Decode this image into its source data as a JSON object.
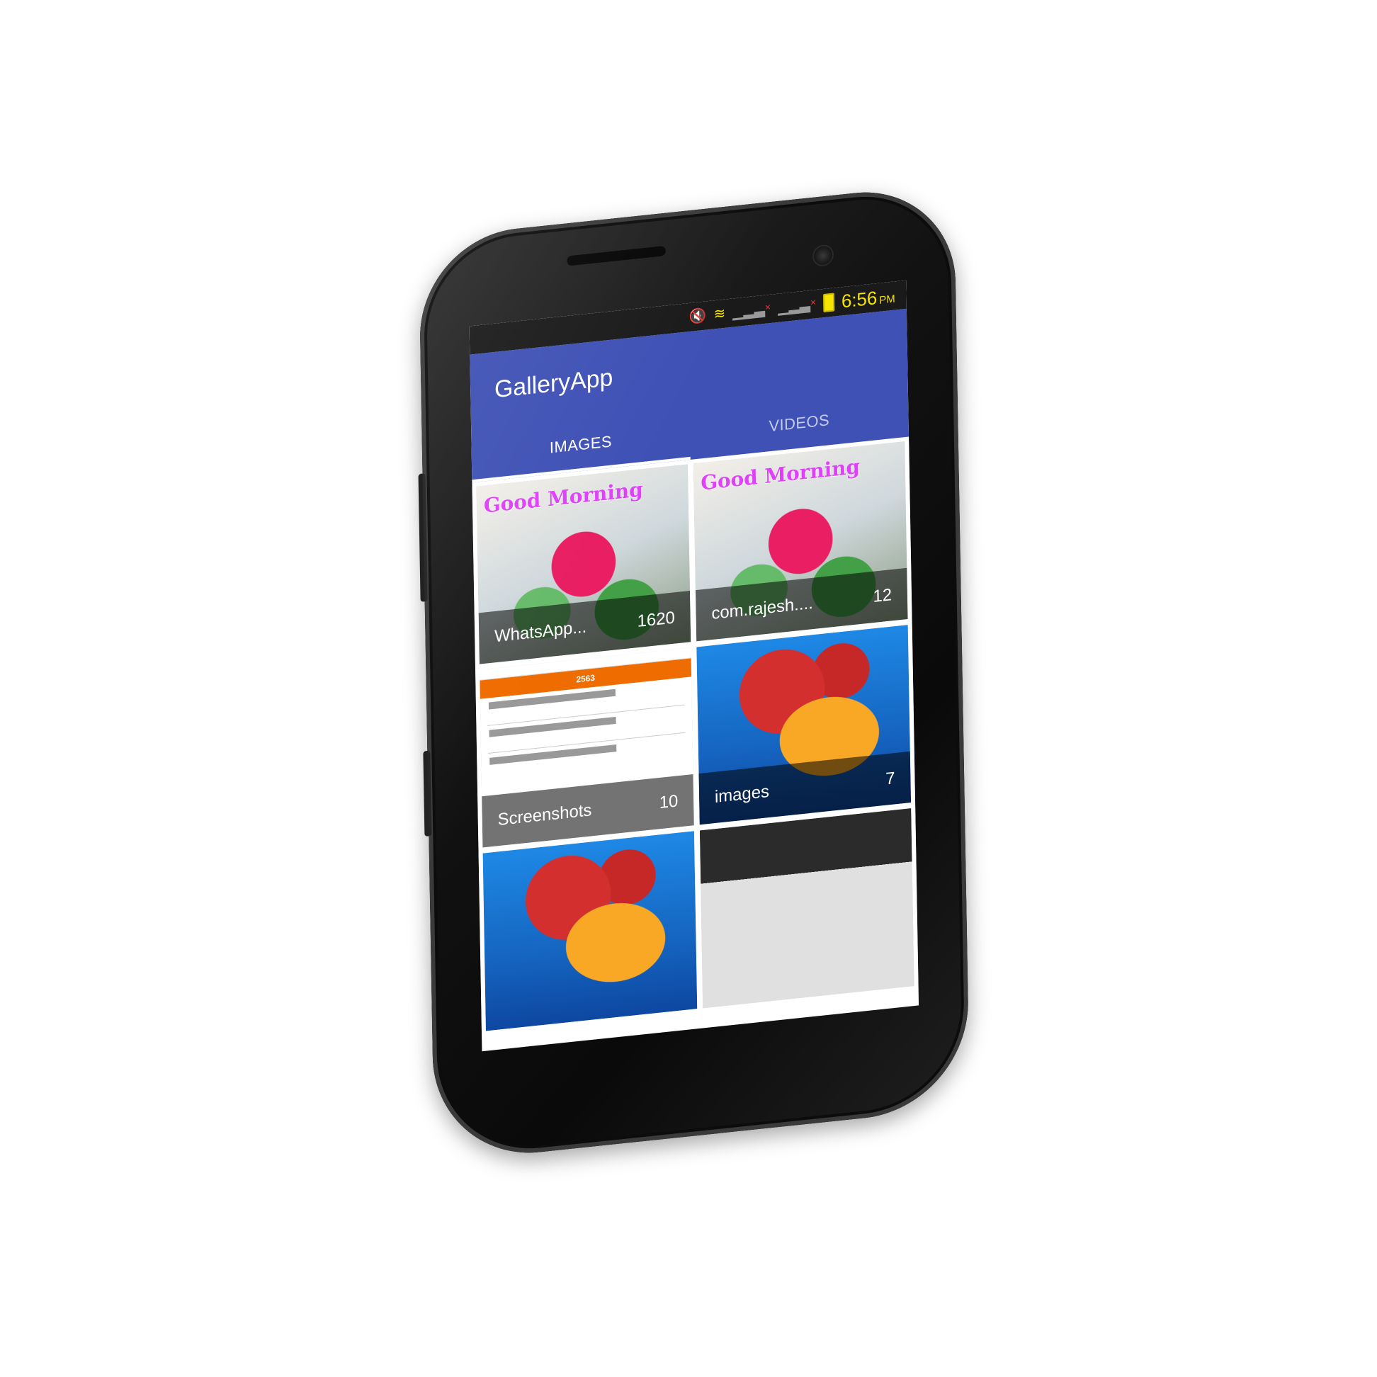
{
  "status_bar": {
    "time": "6:56",
    "ampm": "PM",
    "icons": [
      "mute-icon",
      "wifi-icon",
      "signal-icon",
      "signal-icon",
      "battery-icon"
    ]
  },
  "app": {
    "title": "GalleryApp"
  },
  "tabs": [
    {
      "label": "IMAGES",
      "active": true
    },
    {
      "label": "VIDEOS",
      "active": false
    }
  ],
  "albums": [
    {
      "name": "WhatsApp...",
      "count": "1620",
      "thumb_text": "Good Morning"
    },
    {
      "name": "com.rajesh....",
      "count": "12",
      "thumb_text": "Good Morning"
    },
    {
      "name": "Screenshots",
      "count": "10",
      "thumb_text": "2563"
    },
    {
      "name": "images",
      "count": "7"
    },
    {
      "name": "",
      "count": ""
    },
    {
      "name": "",
      "count": ""
    }
  ],
  "colors": {
    "app_bar": "#3f51b5",
    "status_text": "#f5e400",
    "accent_orange": "#ef6c00"
  }
}
